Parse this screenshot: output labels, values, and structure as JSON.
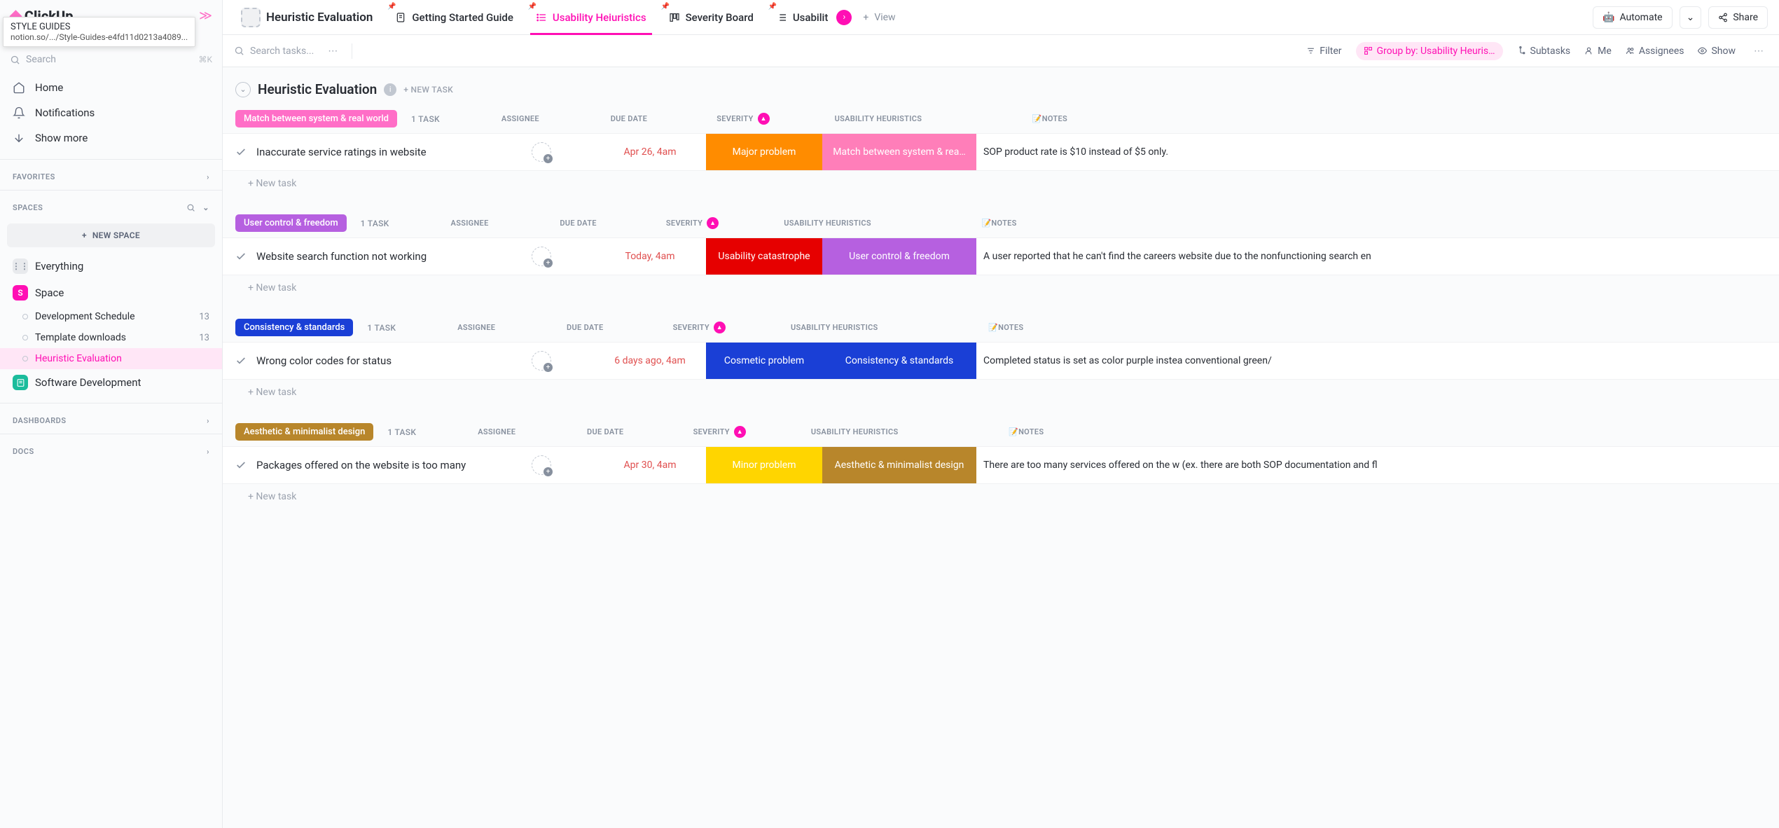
{
  "tooltip": {
    "title": "STYLE GUIDES",
    "url": "notion.so/.../Style-Guides-e4fd11d0213a4089..."
  },
  "logo": "ClickUp",
  "search": {
    "placeholder": "Search",
    "shortcut": "⌘K"
  },
  "nav": {
    "home": "Home",
    "notifications": "Notifications",
    "showmore": "Show more"
  },
  "sections": {
    "favorites": "FAVORITES",
    "spaces": "SPACES",
    "dashboards": "DASHBOARDS",
    "docs": "DOCS"
  },
  "newspace": "NEW SPACE",
  "spaces": {
    "everything": "Everything",
    "space": "Space",
    "space_badge": "S",
    "items": [
      {
        "label": "Development Schedule",
        "count": "13"
      },
      {
        "label": "Template downloads",
        "count": "13"
      },
      {
        "label": "Heuristic Evaluation",
        "count": ""
      }
    ],
    "software": "Software Development"
  },
  "tabs": {
    "title": "Heuristic Evaluation",
    "t1": "Getting Started Guide",
    "t2": "Usability Heiuristics",
    "t3": "Severity Board",
    "t4": "Usabilit",
    "addview": "View",
    "automate": "Automate",
    "share": "Share"
  },
  "toolbar": {
    "search": "Search tasks...",
    "filter": "Filter",
    "groupby": "Group by: Usability Heuris…",
    "subtasks": "Subtasks",
    "me": "Me",
    "assignees": "Assignees",
    "show": "Show"
  },
  "list": {
    "title": "Heuristic Evaluation",
    "newtask": "+ NEW TASK"
  },
  "columns": {
    "assignee": "ASSIGNEE",
    "due": "DUE DATE",
    "severity": "SEVERITY",
    "heuristics": "USABILITY HEURISTICS",
    "notes": "NOTES"
  },
  "newtask_row": "+ New task",
  "groups": [
    {
      "label": "Match between system & real world",
      "color": "#ff6ec7",
      "count": "1 TASK",
      "task": {
        "name": "Inaccurate service ratings in website",
        "due": "Apr 26, 4am",
        "severity": "Major problem",
        "sev_color": "#ff8c00",
        "heur": "Match between system & rea…",
        "heur_color": "#ff7eb9",
        "notes": "SOP product rate is $10 instead of $5 only."
      }
    },
    {
      "label": "User control & freedom",
      "color": "#b660e0",
      "count": "1 TASK",
      "task": {
        "name": "Website search function not working",
        "due": "Today, 4am",
        "severity": "Usability catastrophe",
        "sev_color": "#e60000",
        "heur": "User control & freedom",
        "heur_color": "#b660e0",
        "notes": "A user reported that he can't find the careers website due to the nonfunctioning search en"
      }
    },
    {
      "label": "Consistency & standards",
      "color": "#1a3fd6",
      "count": "1 TASK",
      "task": {
        "name": "Wrong color codes for status",
        "due": "6 days ago, 4am",
        "severity": "Cosmetic problem",
        "sev_color": "#1a3fd6",
        "heur": "Consistency & standards",
        "heur_color": "#1a3fd6",
        "notes": "Completed status is set as color purple instea conventional green/"
      }
    },
    {
      "label": "Aesthetic & minimalist design",
      "color": "#b8862b",
      "count": "1 TASK",
      "task": {
        "name": "Packages offered on the website is too many",
        "due": "Apr 30, 4am",
        "severity": "Minor problem",
        "sev_color": "#ffd500",
        "heur": "Aesthetic & minimalist design",
        "heur_color": "#b8862b",
        "notes": "There are too many services offered on the w (ex. there are both SOP documentation and fl"
      }
    }
  ]
}
